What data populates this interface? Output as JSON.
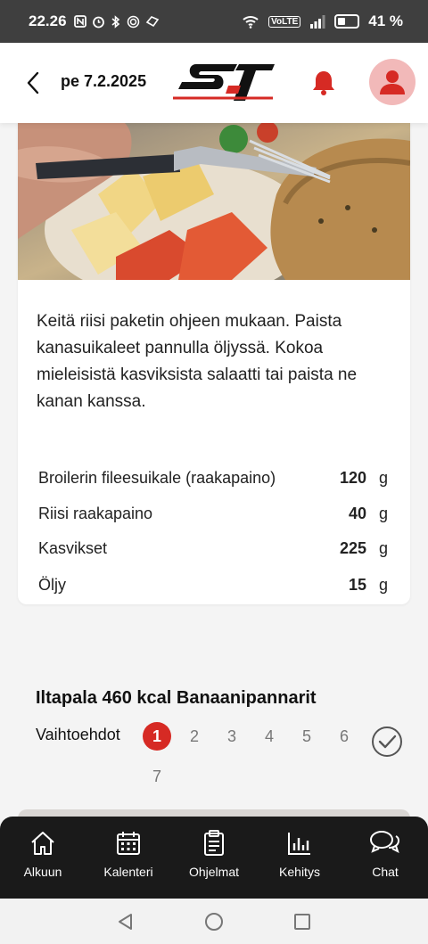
{
  "status_bar": {
    "time": "22.26",
    "icons": [
      "nfc-icon",
      "alarm-icon",
      "bluetooth-icon",
      "hotspot-icon",
      "data-saver-icon",
      "wifi-icon",
      "volte-icon",
      "signal-icon",
      "battery-icon"
    ],
    "volte_label": "VoLTE",
    "battery_percent": 41,
    "battery_label": "41 %"
  },
  "header": {
    "date": "pe 7.2.2025",
    "logo_text": "ST",
    "accent_color": "#d62a24"
  },
  "meal": {
    "instructions": "Keitä riisi paketin ohjeen mukaan. Paista kanasuikaleet pannulla öljyssä. Kokoa mieleisistä kasviksista salaatti tai paista ne kanan kanssa.",
    "ingredients": [
      {
        "name": "Broilerin fileesuikale (raakapaino)",
        "amount": "120",
        "unit": "g"
      },
      {
        "name": "Riisi raakapaino",
        "amount": "40",
        "unit": "g"
      },
      {
        "name": "Kasvikset",
        "amount": "225",
        "unit": "g"
      },
      {
        "name": "Öljy",
        "amount": "15",
        "unit": "g"
      }
    ]
  },
  "snack": {
    "title": "Iltapala 460 kcal Banaanipannarit",
    "options_label": "Vaihtoehdot",
    "options": [
      "1",
      "2",
      "3",
      "4",
      "5",
      "6",
      "7"
    ],
    "selected_option": "1"
  },
  "bottom_nav": {
    "items": [
      {
        "label": "Alkuun",
        "icon": "home-icon"
      },
      {
        "label": "Kalenteri",
        "icon": "calendar-icon"
      },
      {
        "label": "Ohjelmat",
        "icon": "clipboard-icon"
      },
      {
        "label": "Kehitys",
        "icon": "bar-chart-icon"
      },
      {
        "label": "Chat",
        "icon": "chat-icon"
      }
    ]
  },
  "system_nav": [
    "back-triangle-icon",
    "home-circle-icon",
    "recents-square-icon"
  ]
}
